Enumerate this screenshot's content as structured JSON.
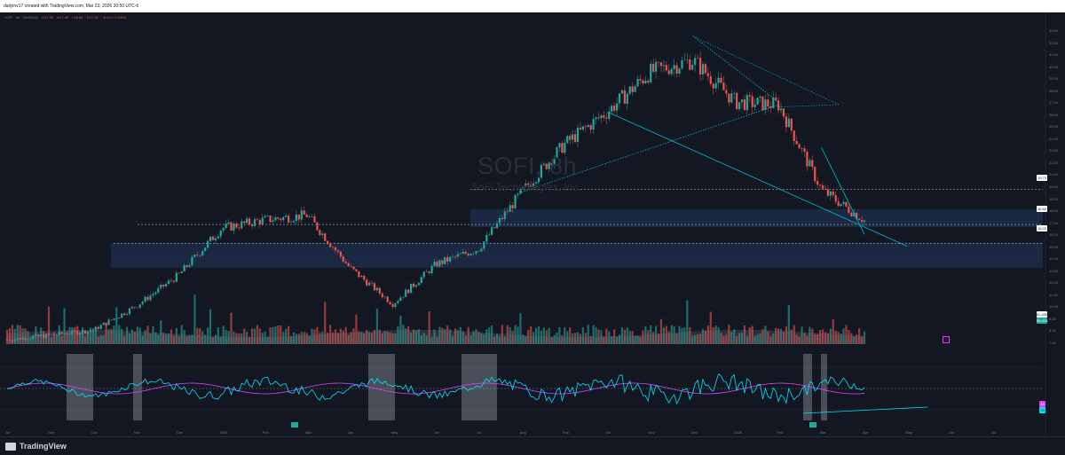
{
  "header": {
    "attribution": "dailyinv17 created with TradingView.com, Mar 23, 2026 20:50 UTC-6"
  },
  "legend": {
    "symbol_line": "SOFI · 8h · NASDAQ",
    "values": [
      "O17.36",
      "H17.45",
      "L16.84",
      "C17.15",
      "−0.04 (−0.23%)"
    ]
  },
  "watermark": {
    "ticker": "SOFI, 8h",
    "name": "SoFi Technologies, Inc."
  },
  "price_labels": [
    {
      "text": "19.73",
      "bg": "#ffffff",
      "fg": "#131722"
    },
    {
      "text": "16.82",
      "bg": "#ffffff",
      "fg": "#131722"
    },
    {
      "text": "15.22",
      "bg": "#ffffff",
      "fg": "#131722"
    }
  ],
  "volume_labels": [
    {
      "text": "62.43K",
      "bg": "#ffffff",
      "fg": "#131722"
    },
    {
      "text": "56.41K",
      "bg": "#26a69a",
      "fg": "#ffffff"
    }
  ],
  "osc_labels": [
    {
      "text": "30",
      "bg": "#e040fb",
      "fg": "#ffffff"
    },
    {
      "text": "28",
      "bg": "#00e5ff",
      "fg": "#131722"
    }
  ],
  "alert_badge": "!",
  "y_ticks": [
    "33.00",
    "32.00",
    "31.00",
    "30.00",
    "29.00",
    "28.00",
    "27.00",
    "26.00",
    "25.00",
    "24.00",
    "23.00",
    "22.00",
    "21.00",
    "20.00",
    "19.00",
    "18.00",
    "17.00",
    "16.00",
    "15.00",
    "14.00",
    "13.00",
    "12.00",
    "11.00",
    "10.00",
    "9.00",
    "8.00",
    "7.00"
  ],
  "x_ticks": [
    "Jul",
    "Sep",
    "Oct",
    "Nov",
    "Dec",
    "2025",
    "Feb",
    "Mar",
    "Apr",
    "May",
    "Jun",
    "Jul",
    "Aug",
    "Sep",
    "Oct",
    "Nov",
    "Dec",
    "2026",
    "Feb",
    "Mar",
    "Apr",
    "May",
    "Jun",
    "Jul"
  ],
  "brand": "TradingView",
  "colors": {
    "bg": "#131722",
    "up": "#26a69a",
    "down": "#ef5350",
    "trendline": "#00bcd4",
    "zone": "#1e2f4d",
    "rsi": "#00e5ff",
    "rsi_ma": "#e040fb",
    "grey_bar": "#b2b5be"
  },
  "chart_data": {
    "type": "candlestick",
    "title": "SOFI, 8h",
    "subtitle": "SoFi Technologies, Inc.",
    "price_axis": {
      "min": 7,
      "max": 33
    },
    "horizontal_levels": [
      19.73,
      16.82,
      15.22
    ],
    "zones": [
      [
        16.6,
        18.1
      ],
      [
        13.2,
        15.3
      ]
    ],
    "trendlines": [
      {
        "from": [
          "Sep 2025",
          26.2
        ],
        "to": [
          "Apr 2026",
          15.0
        ],
        "style": "solid"
      },
      {
        "from": [
          "Jul 2025",
          19.5
        ],
        "to": [
          "Jan 2026",
          26.8
        ],
        "style": "dotted"
      },
      {
        "from": [
          "Nov 2025",
          32.5
        ],
        "to": [
          "Jan 2026",
          27.0
        ],
        "style": "dotted"
      },
      {
        "from": [
          "Feb 2026",
          23.2
        ],
        "to": [
          "Mar 2026",
          16.0
        ],
        "style": "solid"
      }
    ],
    "price_path": [
      {
        "date": "Jul 2024",
        "close": 7.2
      },
      {
        "date": "Aug 2024",
        "close": 7.6
      },
      {
        "date": "Sep 2024",
        "close": 8.0
      },
      {
        "date": "Oct 2024",
        "close": 10.0
      },
      {
        "date": "Nov 2024",
        "close": 12.6
      },
      {
        "date": "Dec 2024",
        "close": 16.5
      },
      {
        "date": "Jan 2025",
        "close": 17.2
      },
      {
        "date": "Feb 2025",
        "close": 17.6
      },
      {
        "date": "Mar 2025",
        "close": 13.2
      },
      {
        "date": "Apr 2025",
        "close": 10.2
      },
      {
        "date": "May 2025",
        "close": 13.5
      },
      {
        "date": "Jun 2025",
        "close": 14.8
      },
      {
        "date": "Jul 2025",
        "close": 19.5
      },
      {
        "date": "Aug 2025",
        "close": 23.5
      },
      {
        "date": "Sep 2025",
        "close": 26.2
      },
      {
        "date": "Oct 2025",
        "close": 29.5
      },
      {
        "date": "Nov 2025",
        "close": 30.5
      },
      {
        "date": "Dec 2025",
        "close": 27.0
      },
      {
        "date": "Jan 2026",
        "close": 26.8
      },
      {
        "date": "Feb 2026",
        "close": 19.7
      },
      {
        "date": "Mar 2026",
        "close": 17.15
      }
    ],
    "volume_last": "62.43K",
    "volume_ma": "56.41K",
    "oscillator": {
      "value": 30,
      "ma": 28
    }
  }
}
